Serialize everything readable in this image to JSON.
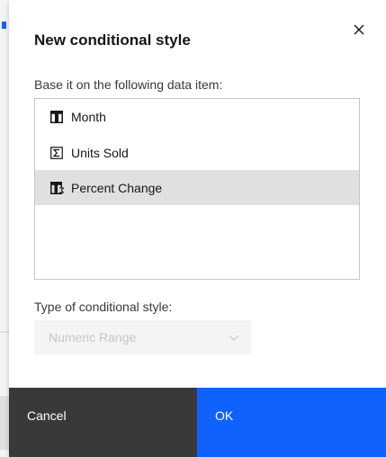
{
  "dialog": {
    "title": "New conditional style",
    "close_icon": "close-icon"
  },
  "data_item": {
    "label": "Base it on the following data item:",
    "items": [
      {
        "label": "Month",
        "icon": "attribute-column-icon",
        "selected": false
      },
      {
        "label": "Units Sold",
        "icon": "sigma-measure-icon",
        "selected": false
      },
      {
        "label": "Percent Change",
        "icon": "calculated-column-icon",
        "selected": true
      }
    ]
  },
  "style_type": {
    "label": "Type of conditional style:",
    "selected_value": "Numeric Range",
    "disabled": true
  },
  "footer": {
    "cancel_label": "Cancel",
    "ok_label": "OK"
  },
  "colors": {
    "primary": "#0f62fe",
    "secondary": "#393939",
    "selected_row": "#e0e0e0"
  }
}
